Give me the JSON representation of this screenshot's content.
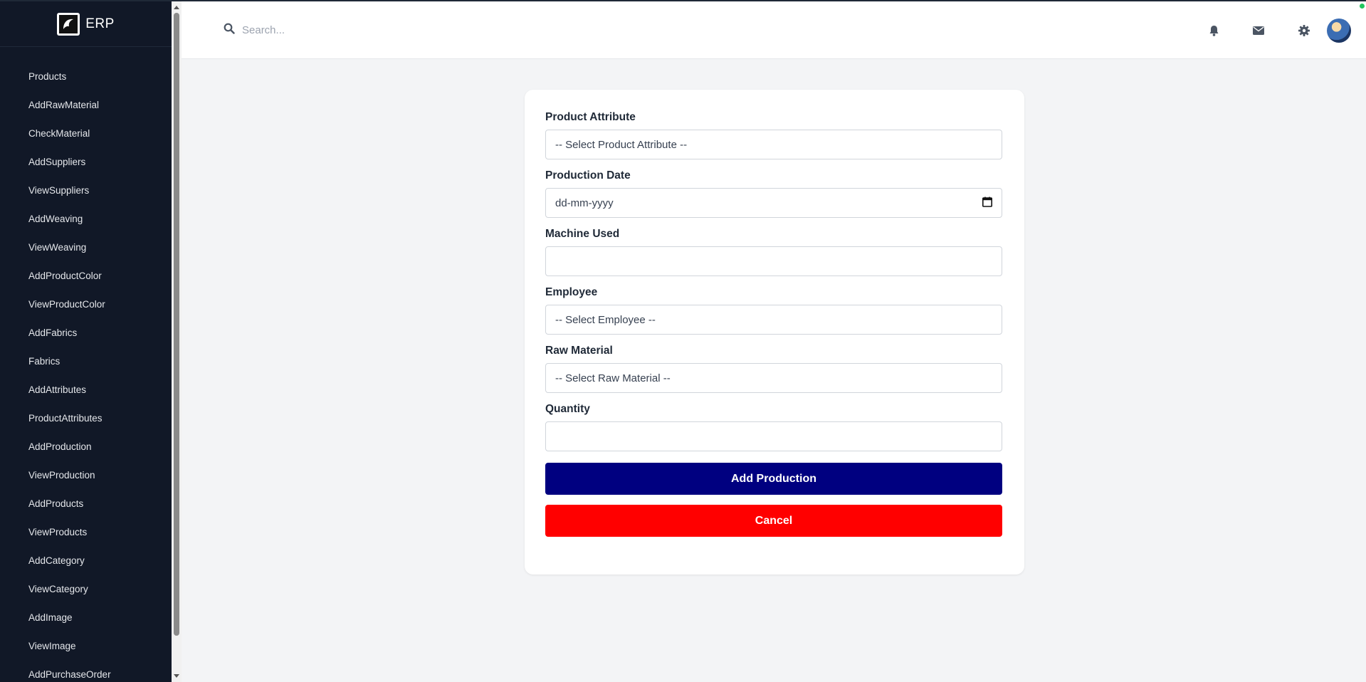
{
  "app": {
    "brand": "ERP"
  },
  "sidebar": {
    "items": [
      {
        "label": "Products"
      },
      {
        "label": "AddRawMaterial"
      },
      {
        "label": "CheckMaterial"
      },
      {
        "label": "AddSuppliers"
      },
      {
        "label": "ViewSuppliers"
      },
      {
        "label": "AddWeaving"
      },
      {
        "label": "ViewWeaving"
      },
      {
        "label": "AddProductColor"
      },
      {
        "label": "ViewProductColor"
      },
      {
        "label": "AddFabrics"
      },
      {
        "label": "Fabrics"
      },
      {
        "label": "AddAttributes"
      },
      {
        "label": "ProductAttributes"
      },
      {
        "label": "AddProduction"
      },
      {
        "label": "ViewProduction"
      },
      {
        "label": "AddProducts"
      },
      {
        "label": "ViewProducts"
      },
      {
        "label": "AddCategory"
      },
      {
        "label": "ViewCategory"
      },
      {
        "label": "AddImage"
      },
      {
        "label": "ViewImage"
      },
      {
        "label": "AddPurchaseOrder"
      }
    ]
  },
  "header": {
    "search": {
      "placeholder": "Search..."
    },
    "icons": [
      "bell-icon",
      "envelope-icon",
      "gear-icon",
      "avatar"
    ]
  },
  "form": {
    "product_attribute": {
      "label": "Product Attribute",
      "value": "-- Select Product Attribute --"
    },
    "production_date": {
      "label": "Production Date",
      "placeholder": "dd-mm-yyyy"
    },
    "machine_used": {
      "label": "Machine Used",
      "value": ""
    },
    "employee": {
      "label": "Employee",
      "value": "-- Select Employee --"
    },
    "raw_material": {
      "label": "Raw Material",
      "value": "-- Select Raw Material --"
    },
    "quantity": {
      "label": "Quantity",
      "value": ""
    },
    "submit_label": "Add Production",
    "cancel_label": "Cancel"
  },
  "colors": {
    "sidebar_bg": "#111827",
    "primary_button": "#000080",
    "cancel_button": "#ff0000",
    "page_bg": "#f3f4f6"
  }
}
